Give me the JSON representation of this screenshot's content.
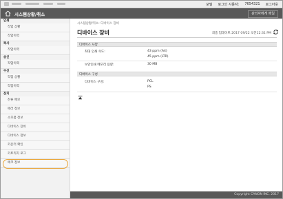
{
  "top": {
    "links": [
      "포털",
      "로그인 사용자:",
      "7654321",
      "로그아웃"
    ]
  },
  "titlebar": {
    "title": "시스템상황/취소",
    "admin_button": "관리자에게 메일"
  },
  "sidebar": {
    "groups": [
      {
        "label": "인쇄",
        "items": [
          "작업 상황",
          "작업이력"
        ]
      },
      {
        "label": "복사",
        "items": [
          "작업이력"
        ]
      },
      {
        "label": "송신",
        "items": [
          "작업이력"
        ]
      },
      {
        "label": "수신",
        "items": [
          "작업 상황",
          "작업이력"
        ]
      },
      {
        "label": "장치",
        "items": [
          "잔류 메모",
          "에러 정보",
          "소모품 정보",
          "디바이스 장비",
          "디바이스 정보",
          "카운터 확인",
          "카트리지 로그",
          "에코 정보"
        ]
      }
    ],
    "selected": "디바이스 장비"
  },
  "main": {
    "breadcrumb": "시스템상황/취소: 디바이스 장비",
    "page_title": "디바이스 장비",
    "last_updated": "최종 업데이트:2017 09/22 오전12:31 PM",
    "sections": [
      {
        "heading": "디바이스 사양",
        "rows": [
          {
            "label": "최대 인쇄 속도:",
            "values": [
              "43 ppm (A4)",
              "45 ppm (LTR)"
            ]
          },
          {
            "label": "보안인쇄 메모리 용량:",
            "values": [
              "30 MB"
            ]
          }
        ]
      },
      {
        "heading": "디바이스 구성",
        "rows": [
          {
            "label": "디바이스 구성:",
            "values": [
              "PCL",
              "PS"
            ]
          }
        ]
      }
    ]
  },
  "footer": {
    "copyright": "Copyright CANON INC. 2017"
  },
  "colors": {
    "titlebar": "#595959",
    "sidebar_bg": "#f2f2f2",
    "highlight": "#e8a334"
  }
}
